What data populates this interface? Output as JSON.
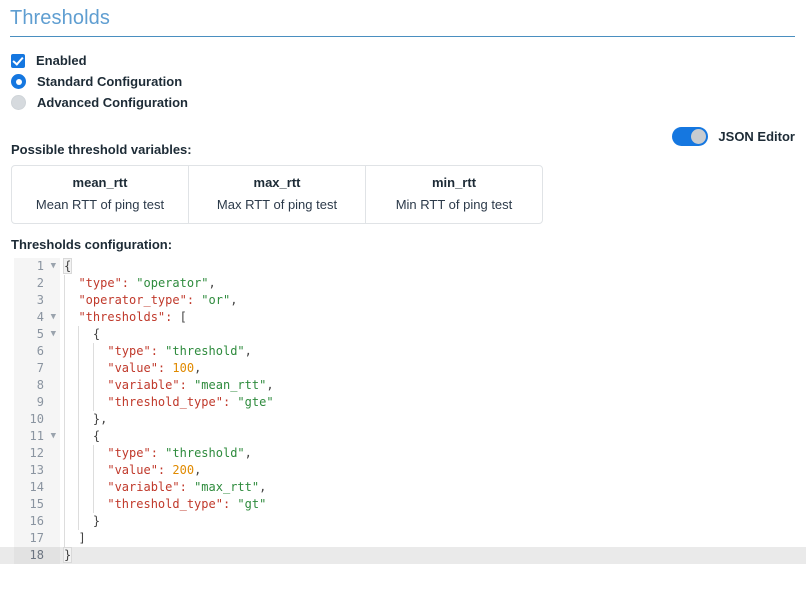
{
  "page": {
    "title": "Thresholds"
  },
  "options": {
    "enabled": {
      "label": "Enabled",
      "checked": true
    },
    "standard": {
      "label": "Standard Configuration",
      "selected": true
    },
    "advanced": {
      "label": "Advanced Configuration",
      "selected": false
    }
  },
  "json_editor_toggle": {
    "label": "JSON Editor",
    "on": true,
    "color": "#1577e0"
  },
  "variables": {
    "label": "Possible threshold variables:",
    "items": [
      {
        "name": "mean_rtt",
        "description": "Mean RTT of ping test"
      },
      {
        "name": "max_rtt",
        "description": "Max RTT of ping test"
      },
      {
        "name": "min_rtt",
        "description": "Min RTT of ping test"
      }
    ]
  },
  "configuration": {
    "label": "Thresholds configuration:",
    "active_line": 18,
    "fold_lines": [
      1,
      4,
      5,
      11
    ],
    "lines": [
      {
        "num": 1,
        "indent": 0,
        "text": "{"
      },
      {
        "num": 2,
        "indent": 1,
        "text": "\"type\": \"operator\","
      },
      {
        "num": 3,
        "indent": 1,
        "text": "\"operator_type\": \"or\","
      },
      {
        "num": 4,
        "indent": 1,
        "text": "\"thresholds\": ["
      },
      {
        "num": 5,
        "indent": 2,
        "text": "{"
      },
      {
        "num": 6,
        "indent": 3,
        "text": "\"type\": \"threshold\","
      },
      {
        "num": 7,
        "indent": 3,
        "text": "\"value\": 100,"
      },
      {
        "num": 8,
        "indent": 3,
        "text": "\"variable\": \"mean_rtt\","
      },
      {
        "num": 9,
        "indent": 3,
        "text": "\"threshold_type\": \"gte\""
      },
      {
        "num": 10,
        "indent": 2,
        "text": "},"
      },
      {
        "num": 11,
        "indent": 2,
        "text": "{"
      },
      {
        "num": 12,
        "indent": 3,
        "text": "\"type\": \"threshold\","
      },
      {
        "num": 13,
        "indent": 3,
        "text": "\"value\": 200,"
      },
      {
        "num": 14,
        "indent": 3,
        "text": "\"variable\": \"max_rtt\","
      },
      {
        "num": 15,
        "indent": 3,
        "text": "\"threshold_type\": \"gt\""
      },
      {
        "num": 16,
        "indent": 2,
        "text": "}"
      },
      {
        "num": 17,
        "indent": 1,
        "text": "]"
      },
      {
        "num": 18,
        "indent": 0,
        "text": "}"
      }
    ],
    "json_value": {
      "type": "operator",
      "operator_type": "or",
      "thresholds": [
        {
          "type": "threshold",
          "value": 100,
          "variable": "mean_rtt",
          "threshold_type": "gte"
        },
        {
          "type": "threshold",
          "value": 200,
          "variable": "max_rtt",
          "threshold_type": "gt"
        }
      ]
    }
  },
  "colors": {
    "title": "#5f9ed1",
    "rule": "#4a8fc0",
    "accent": "#1577e0",
    "key": "#c0392b",
    "string": "#2e8b3d",
    "number": "#e08a00"
  }
}
